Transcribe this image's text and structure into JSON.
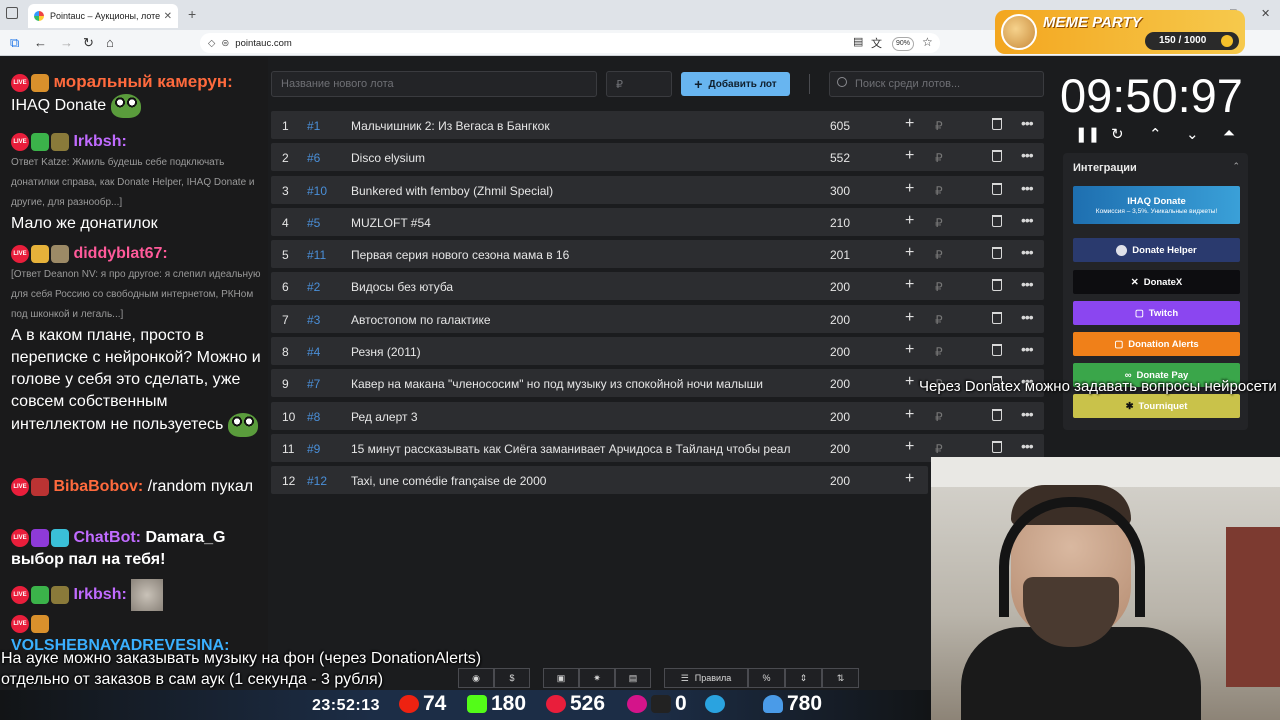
{
  "browser": {
    "tab_title": "Pointauc – Аукционы, лотереи",
    "tab_close": "✕",
    "new_tab": "+",
    "url": "pointauc.com",
    "zoom": "90%"
  },
  "meme_party": {
    "title": "MEME PARTY",
    "progress_text": "150 / 1000"
  },
  "chat": {
    "messages": [
      {
        "nick": "моральный камерун:",
        "text": "IHAQ Donate"
      },
      {
        "nick": "Irkbsh:",
        "reply": "Ответ Katze: Жмиль будешь себе подключать донатилки справа, как Donate Helper, IHAQ Donate и другие, для разнообр...]",
        "text": "Мало же донатилок"
      },
      {
        "nick": "diddyblat67:",
        "reply": "[Ответ Deanon NV: я про другое: я слепил идеальную для себя Россию со свободным интернетом, РКНом под шконкой и легаль...]",
        "text": "А в каком плане, просто в переписке с нейронкой? Можно и голове у себя это сделать, уже совсем собственным интеллектом не пользуетесь"
      },
      {
        "nick": "BibaBobov:",
        "text": "/random пукал"
      },
      {
        "nick": "ChatBot:",
        "text": "Damara_G выбор пал на тебя!"
      },
      {
        "nick": "Irkbsh:",
        "text": ""
      },
      {
        "nick": "VOLSHEBNAYADREVESINA:",
        "text": ""
      }
    ],
    "live_badge": "LIVE"
  },
  "lots_form": {
    "name_placeholder": "Название нового лота",
    "amount_placeholder": "₽",
    "add_button": "Добавить лот",
    "search_placeholder": "Поиск среди лотов..."
  },
  "lots": [
    {
      "num": "1",
      "tag": "#1",
      "title": "Мальчишник 2: Из Вегаса в Бангкок",
      "amount": "605"
    },
    {
      "num": "2",
      "tag": "#6",
      "title": "Disco elysium",
      "amount": "552"
    },
    {
      "num": "3",
      "tag": "#10",
      "title": "Bunkered with femboy (Zhmil Special)",
      "amount": "300"
    },
    {
      "num": "4",
      "tag": "#5",
      "title": "MUZLOFT #54",
      "amount": "210"
    },
    {
      "num": "5",
      "tag": "#11",
      "title": "Первая серия нового сезона мама в 16",
      "amount": "201"
    },
    {
      "num": "6",
      "tag": "#2",
      "title": "Видосы без ютуба",
      "amount": "200"
    },
    {
      "num": "7",
      "tag": "#3",
      "title": "Автостопом по галактике",
      "amount": "200"
    },
    {
      "num": "8",
      "tag": "#4",
      "title": "Резня (2011)",
      "amount": "200"
    },
    {
      "num": "9",
      "tag": "#7",
      "title": "Кавер на макана \"членососим\" но под музыку из спокойной ночи малыши",
      "amount": "200"
    },
    {
      "num": "10",
      "tag": "#8",
      "title": "Ред алерт 3",
      "amount": "200"
    },
    {
      "num": "11",
      "tag": "#9",
      "title": "15 минут рассказывать как Сиёга заманивает Арчидоса в Тайланд чтобы реал",
      "amount": "200"
    },
    {
      "num": "12",
      "tag": "#12",
      "title": "Taxi, une comédie française de 2000",
      "amount": "200"
    }
  ],
  "row_icons": {
    "plus": "+",
    "rub": "₽",
    "more": "•••"
  },
  "timer": {
    "value": "09:50:97"
  },
  "integrations": {
    "header": "Интеграции",
    "buttons": [
      {
        "label": "IHAQ Donate",
        "sub": "Комиссия – 3,5%. Уникальные виджеты!",
        "color": "#2f86c6"
      },
      {
        "label": "Donate Helper",
        "color": "#2a3a6e"
      },
      {
        "label": "DonateX",
        "color": "#0d0d10"
      },
      {
        "label": "Twitch",
        "color": "#8b46f0"
      },
      {
        "label": "Donation Alerts",
        "color": "#f08019"
      },
      {
        "label": "Donate Pay",
        "color": "#3aa64a"
      },
      {
        "label": "Tourniquet",
        "color": "#c9c24a"
      }
    ]
  },
  "overlays": {
    "donatex_note": "Через Donatex можно задавать вопросы нейросети",
    "music_note_1": "На ауке можно заказывать музыку на фон (через DonationAlerts)",
    "music_note_2": "отдельно от заказов в сам аук (1 секунда - 3 рубля)"
  },
  "toolbar": {
    "rules": "Правила",
    "percent": "%"
  },
  "status": {
    "clock": "23:52:13",
    "youtube": "74",
    "kick": "180",
    "live": "526",
    "other": "0",
    "viewers": "780"
  }
}
